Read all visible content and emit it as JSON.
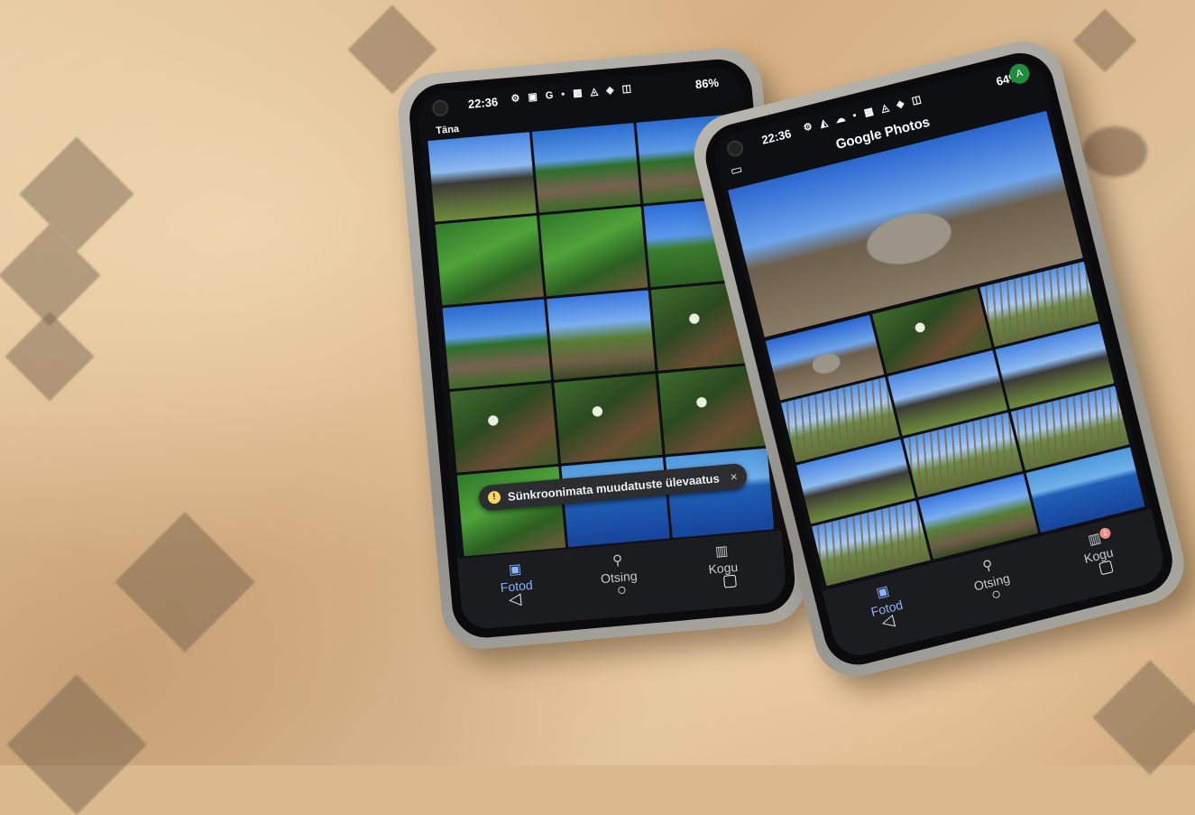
{
  "scene": {
    "description_colors": {
      "table": "#d9b98e",
      "case": "#a7a69f",
      "accent": "#8ab4f8"
    }
  },
  "phone_left": {
    "status": {
      "time": "22:36",
      "icons": "⚙ ▣ G •  ▩ ◬ ◈ ◫",
      "battery": "86%"
    },
    "section_label": "Täna",
    "toast": {
      "text": "Sünkroonimata muudatuste ülevaatus",
      "close": "×",
      "icon": "!"
    },
    "tabs": [
      {
        "label": "Fotod",
        "icon": "photos-icon",
        "active": true
      },
      {
        "label": "Otsing",
        "icon": "search-icon",
        "active": false
      },
      {
        "label": "Kogu",
        "icon": "library-icon",
        "active": false
      }
    ],
    "sysnav": [
      "◁",
      "○",
      "▢"
    ]
  },
  "phone_right": {
    "status": {
      "time": "22:36",
      "icons": "⚙ ◭ ☁ •  ▩ ◬ ◈ ◫",
      "battery": "64%"
    },
    "app_title": "Google Photos",
    "avatar_letter": "A",
    "tabs": [
      {
        "label": "Fotod",
        "icon": "photos-icon",
        "active": true
      },
      {
        "label": "Otsing",
        "icon": "search-icon",
        "active": false
      },
      {
        "label": "Kogu",
        "icon": "library-icon",
        "active": false
      }
    ],
    "library_badge": "2",
    "sysnav": [
      "◁",
      "○",
      "▢"
    ]
  }
}
